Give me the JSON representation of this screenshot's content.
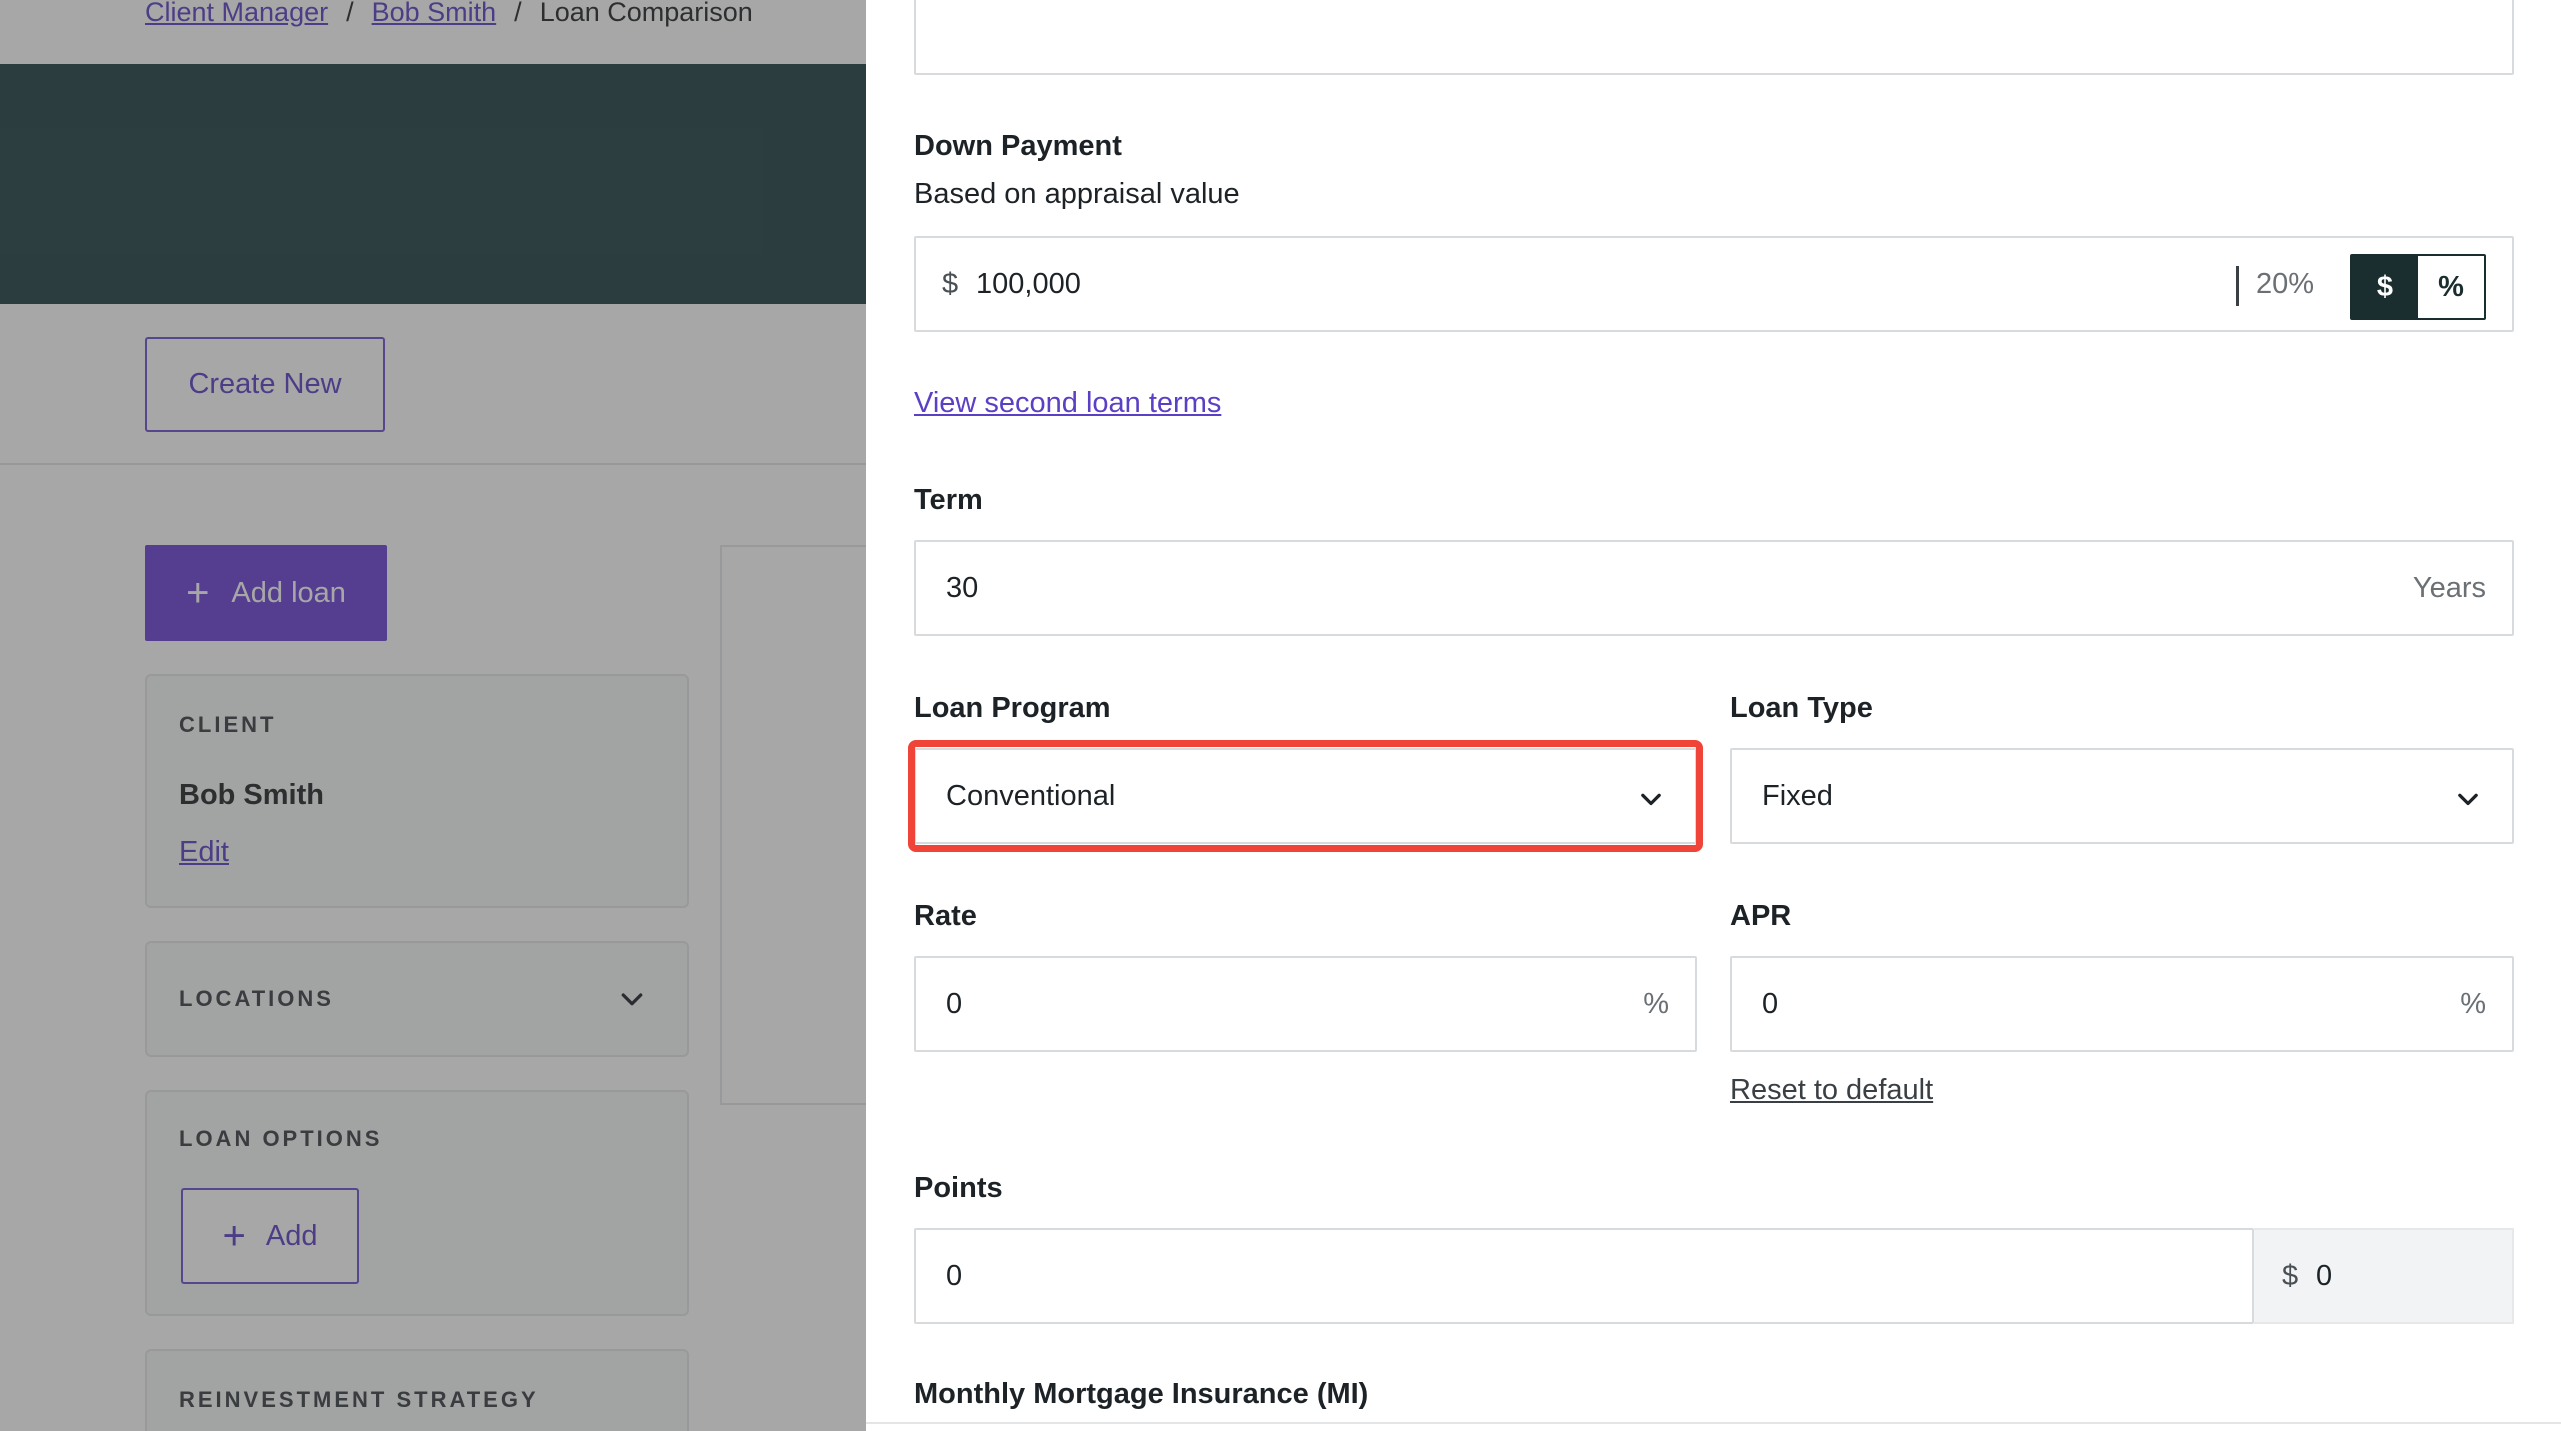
{
  "background": {
    "breadcrumbs": [
      {
        "label": "Client Manager",
        "link": true
      },
      {
        "label": "Bob Smith",
        "link": true
      },
      {
        "label": "Loan Comparison",
        "link": false
      }
    ],
    "create_new_label": "Create New",
    "add_loan_label": "Add loan",
    "client": {
      "label": "CLIENT",
      "name": "Bob Smith",
      "edit_label": "Edit"
    },
    "locations_label": "LOCATIONS",
    "loan_options": {
      "label": "LOAN OPTIONS",
      "add_label": "Add"
    },
    "reinvestment_label": "REINVESTMENT STRATEGY"
  },
  "drawer": {
    "down_payment": {
      "label": "Down Payment",
      "sublabel": "Based on appraisal value",
      "currency_symbol": "$",
      "value": "100,000",
      "percent_display": "20%",
      "toggle_dollar": "$",
      "toggle_percent": "%",
      "selected_unit": "$"
    },
    "second_loan_link": "View second loan terms",
    "term": {
      "label": "Term",
      "value": "30",
      "suffix": "Years"
    },
    "loan_program": {
      "label": "Loan Program",
      "value": "Conventional"
    },
    "loan_type": {
      "label": "Loan Type",
      "value": "Fixed"
    },
    "rate": {
      "label": "Rate",
      "value": "0",
      "suffix": "%"
    },
    "apr": {
      "label": "APR",
      "value": "0",
      "suffix": "%",
      "reset_label": "Reset to default"
    },
    "points": {
      "label": "Points",
      "value": "0",
      "currency_symbol": "$",
      "amount": "0"
    },
    "mortgage_insurance_label": "Monthly Mortgage Insurance (MI)"
  },
  "colors": {
    "accent": "#6a3fd6",
    "teal_header": "#1e3f41",
    "highlight": "#f04438",
    "toggle_active": "#1a2e2f"
  }
}
